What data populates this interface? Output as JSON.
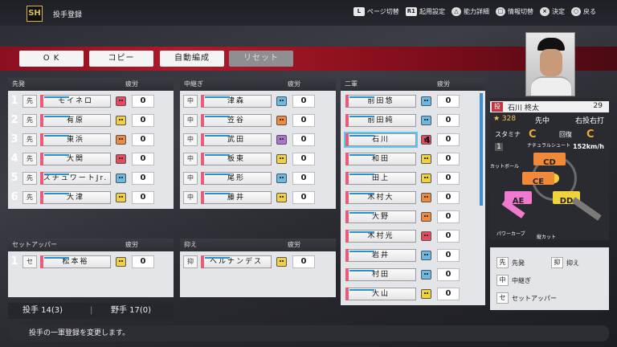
{
  "header": {
    "title": "投手登録",
    "logo_text": "SH",
    "hints": [
      {
        "key": "L",
        "label": "ページ切替"
      },
      {
        "key": "R1",
        "label": "起用設定"
      },
      {
        "key": "△",
        "label": "能力詳細"
      },
      {
        "key": "□",
        "label": "情報切替"
      },
      {
        "key": "×",
        "label": "決定"
      },
      {
        "key": "○",
        "label": "戻る"
      }
    ]
  },
  "buttons": {
    "ok": "O K",
    "copy": "コピー",
    "auto": "自動編成",
    "reset": "リセット"
  },
  "starters": {
    "title": "先発",
    "fatigue_label": "疲労",
    "rows": [
      {
        "num": "1",
        "role": "先",
        "name": "モイネロ",
        "face": "red",
        "fatigue": "0"
      },
      {
        "num": "2",
        "role": "先",
        "name": "有原",
        "face": "yellow",
        "fatigue": "0"
      },
      {
        "num": "3",
        "role": "先",
        "name": "東浜",
        "face": "orange",
        "fatigue": "0"
      },
      {
        "num": "4",
        "role": "先",
        "name": "大関",
        "face": "red",
        "fatigue": "0"
      },
      {
        "num": "5",
        "role": "先",
        "name": "スチュワートJr.",
        "face": "blue",
        "fatigue": "0"
      },
      {
        "num": "6",
        "role": "先",
        "name": "大津",
        "face": "yellow",
        "fatigue": "0"
      }
    ]
  },
  "middle": {
    "title": "中継ぎ",
    "fatigue_label": "疲労",
    "rows": [
      {
        "role": "中",
        "name": "津森",
        "face": "blue",
        "fatigue": "0"
      },
      {
        "role": "中",
        "name": "笠谷",
        "face": "orange",
        "fatigue": "0"
      },
      {
        "role": "中",
        "name": "武田",
        "face": "purple",
        "fatigue": "0"
      },
      {
        "role": "中",
        "name": "板東",
        "face": "yellow",
        "fatigue": "0"
      },
      {
        "role": "中",
        "name": "尾形",
        "face": "blue",
        "fatigue": "0"
      },
      {
        "role": "中",
        "name": "藤井",
        "face": "yellow",
        "fatigue": "0"
      }
    ]
  },
  "farm": {
    "title": "二軍",
    "fatigue_label": "疲労",
    "rows": [
      {
        "name": "前田悠",
        "face": "blue",
        "fatigue": "0"
      },
      {
        "name": "前田純",
        "face": "blue",
        "fatigue": "0"
      },
      {
        "name": "石川",
        "face": "red",
        "fatigue": "0",
        "selected": true
      },
      {
        "name": "和田",
        "face": "yellow",
        "fatigue": "0"
      },
      {
        "name": "田上",
        "face": "yellow",
        "fatigue": "0"
      },
      {
        "name": "木村大",
        "face": "orange",
        "fatigue": "0"
      },
      {
        "name": "大野",
        "face": "orange",
        "fatigue": "0"
      },
      {
        "name": "木村光",
        "face": "red",
        "fatigue": "0"
      },
      {
        "name": "岩井",
        "face": "blue",
        "fatigue": "0"
      },
      {
        "name": "村田",
        "face": "blue",
        "fatigue": "0"
      },
      {
        "name": "大山",
        "face": "yellow",
        "fatigue": "0"
      }
    ]
  },
  "setup": {
    "title": "セットアッパー",
    "fatigue_label": "疲労",
    "rows": [
      {
        "num": "1",
        "role": "セ",
        "name": "松本裕",
        "face": "yellow",
        "fatigue": "0"
      }
    ]
  },
  "closer": {
    "title": "抑え",
    "fatigue_label": "疲労",
    "rows": [
      {
        "role": "抑",
        "name": "ヘルナンデス",
        "face": "yellow",
        "fatigue": "0"
      }
    ]
  },
  "summary": {
    "pitchers": "投手 14(3)",
    "fielders": "野手 17(0)"
  },
  "player": {
    "role": "投",
    "name": "石川 柊太",
    "number": "29",
    "star": "★ 328",
    "position": "先中",
    "handed": "右投右打",
    "stamina_label": "スタミナ",
    "stamina_grade": "C",
    "recovery_label": "回復",
    "recovery_grade": "C",
    "velocity_label": "1",
    "velocity": "152km/h",
    "pitches": [
      {
        "name": "ナチュラルシュート"
      },
      {
        "name": "カットボール",
        "grade": "CD"
      },
      {
        "name": "パワーカーブ",
        "grade": "AE"
      },
      {
        "name": "縦カット",
        "grade": "DD"
      },
      {
        "name": "",
        "grade": "CE"
      }
    ]
  },
  "legend": [
    {
      "key": "先",
      "label": "先発"
    },
    {
      "key": "抑",
      "label": "抑え"
    },
    {
      "key": "中",
      "label": "中継ぎ"
    },
    {
      "key": "セ",
      "label": "セットアッパー"
    }
  ],
  "footer": {
    "message": "投手の一軍登録を変更します。"
  },
  "cursor_number": "4",
  "colors": {
    "accent": "#b01a2a",
    "selection": "#5bc8ee"
  }
}
